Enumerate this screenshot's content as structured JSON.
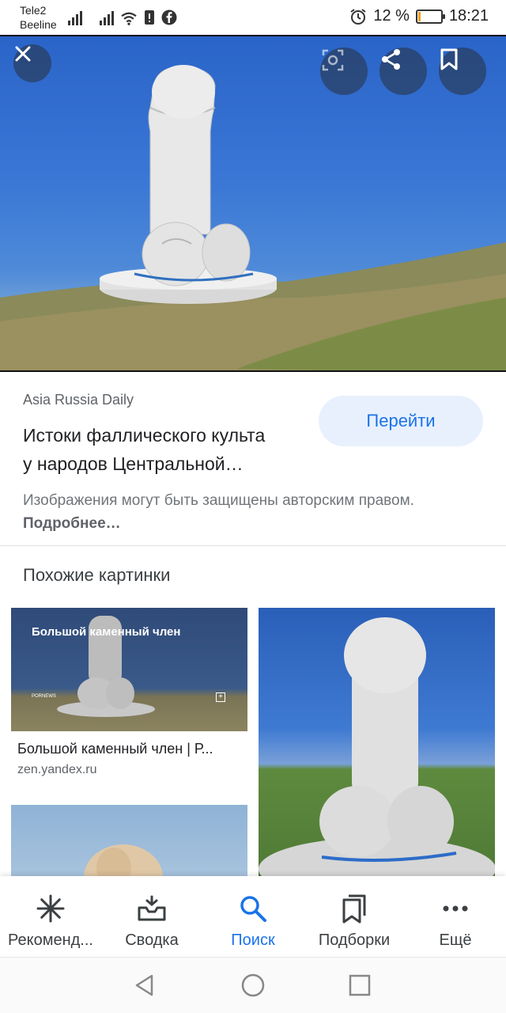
{
  "status_bar": {
    "carrier_1": "Tele2",
    "carrier_2": "Beeline",
    "battery_percent": "12 %",
    "battery_level": 0.12,
    "time": "18:21"
  },
  "hero": {
    "close_icon": "close-icon",
    "lens_icon": "lens-icon",
    "share_icon": "share-icon",
    "bookmark_icon": "bookmark-icon"
  },
  "result": {
    "source": "Asia Russia Daily",
    "title_line_1": "Истоки фаллического культа",
    "title_line_2": "у народов Центральной…",
    "go_label": "Перейти",
    "copyright_text": "Изображения могут быть защищены авторским правом.",
    "copyright_more": "Подробнее…"
  },
  "similar": {
    "heading": "Похожие картинки",
    "items": [
      {
        "overlay_title": "Большой каменный член",
        "overlay_tag": "PORNEWS",
        "caption": "Большой каменный член | Р...",
        "domain": "zen.yandex.ru"
      }
    ]
  },
  "bottom_nav": {
    "items": [
      {
        "label": "Рекоменд...",
        "icon": "sparkle-icon"
      },
      {
        "label": "Сводка",
        "icon": "inbox-icon"
      },
      {
        "label": "Поиск",
        "icon": "search-icon"
      },
      {
        "label": "Подборки",
        "icon": "collections-icon"
      },
      {
        "label": "Ещё",
        "icon": "more-icon"
      }
    ],
    "active_index": 2
  },
  "colors": {
    "accent": "#1a73e8",
    "button_bg": "#e8f0fe"
  }
}
